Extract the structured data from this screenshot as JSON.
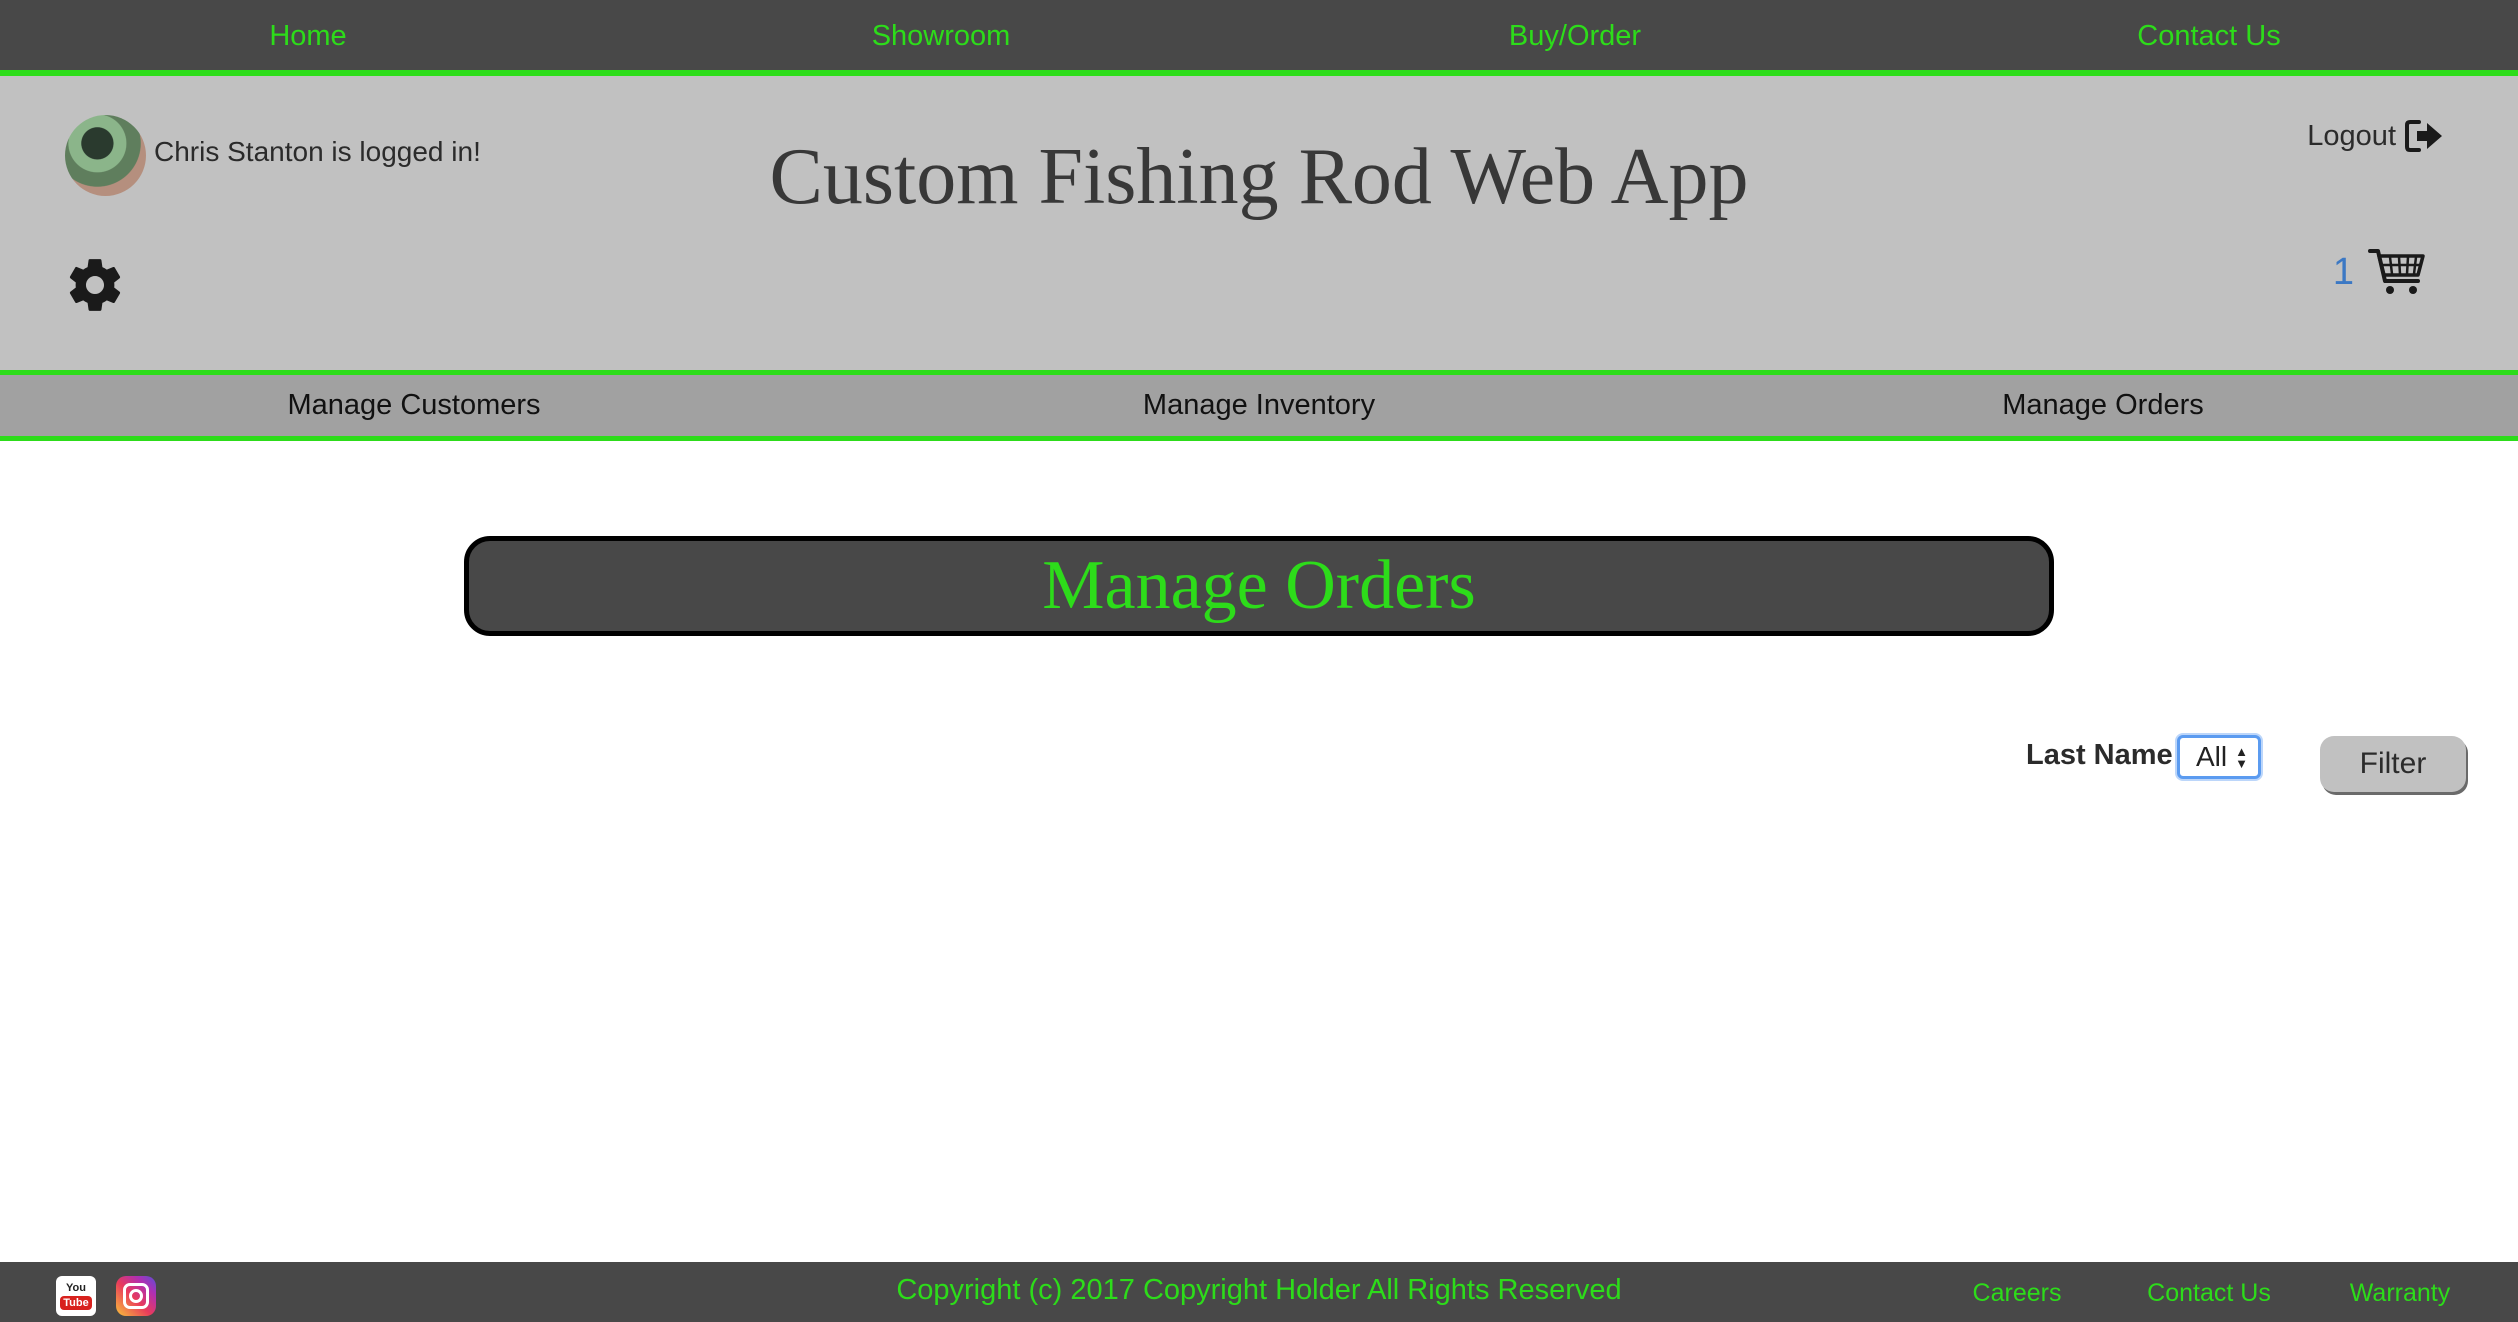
{
  "topnav": {
    "items": [
      {
        "label": "Home"
      },
      {
        "label": "Showroom"
      },
      {
        "label": "Buy/Order"
      },
      {
        "label": "Contact Us"
      }
    ]
  },
  "header": {
    "login_status": "Chris Stanton is logged in!",
    "title": "Custom Fishing Rod Web App",
    "logout_label": "Logout",
    "cart_count": "1"
  },
  "subnav": {
    "items": [
      {
        "label": "Manage Customers"
      },
      {
        "label": "Manage Inventory"
      },
      {
        "label": "Manage Orders"
      }
    ]
  },
  "main": {
    "heading": "Manage Orders",
    "filter": {
      "label": "Last Name",
      "selected": "All",
      "button_label": "Filter"
    }
  },
  "footer": {
    "youtube_top": "You",
    "youtube_bottom": "Tube",
    "copyright": "Copyright (c) 2017 Copyright Holder All Rights Reserved",
    "links": [
      {
        "label": "Careers"
      },
      {
        "label": "Contact Us"
      },
      {
        "label": "Warranty"
      }
    ]
  },
  "colors": {
    "accent_green": "#2ddc1a",
    "dark_bar": "#484848",
    "header_bg": "#c1c1c1",
    "subnav_bg": "#a1a1a1",
    "cart_count": "#3b78c4"
  }
}
